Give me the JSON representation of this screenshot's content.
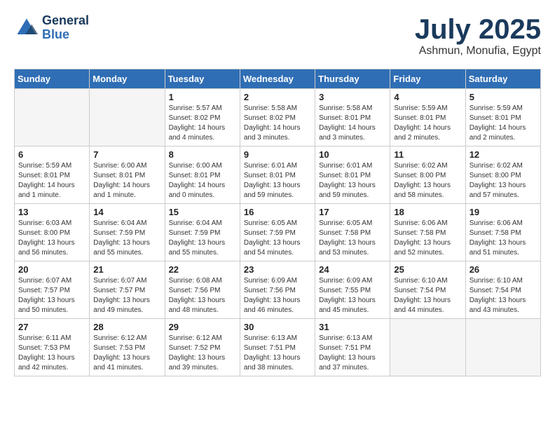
{
  "header": {
    "logo_general": "General",
    "logo_blue": "Blue",
    "month": "July 2025",
    "location": "Ashmun, Monufia, Egypt"
  },
  "weekdays": [
    "Sunday",
    "Monday",
    "Tuesday",
    "Wednesday",
    "Thursday",
    "Friday",
    "Saturday"
  ],
  "weeks": [
    [
      {
        "day": "",
        "info": ""
      },
      {
        "day": "",
        "info": ""
      },
      {
        "day": "1",
        "info": "Sunrise: 5:57 AM\nSunset: 8:02 PM\nDaylight: 14 hours and 4 minutes."
      },
      {
        "day": "2",
        "info": "Sunrise: 5:58 AM\nSunset: 8:02 PM\nDaylight: 14 hours and 3 minutes."
      },
      {
        "day": "3",
        "info": "Sunrise: 5:58 AM\nSunset: 8:01 PM\nDaylight: 14 hours and 3 minutes."
      },
      {
        "day": "4",
        "info": "Sunrise: 5:59 AM\nSunset: 8:01 PM\nDaylight: 14 hours and 2 minutes."
      },
      {
        "day": "5",
        "info": "Sunrise: 5:59 AM\nSunset: 8:01 PM\nDaylight: 14 hours and 2 minutes."
      }
    ],
    [
      {
        "day": "6",
        "info": "Sunrise: 5:59 AM\nSunset: 8:01 PM\nDaylight: 14 hours and 1 minute."
      },
      {
        "day": "7",
        "info": "Sunrise: 6:00 AM\nSunset: 8:01 PM\nDaylight: 14 hours and 1 minute."
      },
      {
        "day": "8",
        "info": "Sunrise: 6:00 AM\nSunset: 8:01 PM\nDaylight: 14 hours and 0 minutes."
      },
      {
        "day": "9",
        "info": "Sunrise: 6:01 AM\nSunset: 8:01 PM\nDaylight: 13 hours and 59 minutes."
      },
      {
        "day": "10",
        "info": "Sunrise: 6:01 AM\nSunset: 8:01 PM\nDaylight: 13 hours and 59 minutes."
      },
      {
        "day": "11",
        "info": "Sunrise: 6:02 AM\nSunset: 8:00 PM\nDaylight: 13 hours and 58 minutes."
      },
      {
        "day": "12",
        "info": "Sunrise: 6:02 AM\nSunset: 8:00 PM\nDaylight: 13 hours and 57 minutes."
      }
    ],
    [
      {
        "day": "13",
        "info": "Sunrise: 6:03 AM\nSunset: 8:00 PM\nDaylight: 13 hours and 56 minutes."
      },
      {
        "day": "14",
        "info": "Sunrise: 6:04 AM\nSunset: 7:59 PM\nDaylight: 13 hours and 55 minutes."
      },
      {
        "day": "15",
        "info": "Sunrise: 6:04 AM\nSunset: 7:59 PM\nDaylight: 13 hours and 55 minutes."
      },
      {
        "day": "16",
        "info": "Sunrise: 6:05 AM\nSunset: 7:59 PM\nDaylight: 13 hours and 54 minutes."
      },
      {
        "day": "17",
        "info": "Sunrise: 6:05 AM\nSunset: 7:58 PM\nDaylight: 13 hours and 53 minutes."
      },
      {
        "day": "18",
        "info": "Sunrise: 6:06 AM\nSunset: 7:58 PM\nDaylight: 13 hours and 52 minutes."
      },
      {
        "day": "19",
        "info": "Sunrise: 6:06 AM\nSunset: 7:58 PM\nDaylight: 13 hours and 51 minutes."
      }
    ],
    [
      {
        "day": "20",
        "info": "Sunrise: 6:07 AM\nSunset: 7:57 PM\nDaylight: 13 hours and 50 minutes."
      },
      {
        "day": "21",
        "info": "Sunrise: 6:07 AM\nSunset: 7:57 PM\nDaylight: 13 hours and 49 minutes."
      },
      {
        "day": "22",
        "info": "Sunrise: 6:08 AM\nSunset: 7:56 PM\nDaylight: 13 hours and 48 minutes."
      },
      {
        "day": "23",
        "info": "Sunrise: 6:09 AM\nSunset: 7:56 PM\nDaylight: 13 hours and 46 minutes."
      },
      {
        "day": "24",
        "info": "Sunrise: 6:09 AM\nSunset: 7:55 PM\nDaylight: 13 hours and 45 minutes."
      },
      {
        "day": "25",
        "info": "Sunrise: 6:10 AM\nSunset: 7:54 PM\nDaylight: 13 hours and 44 minutes."
      },
      {
        "day": "26",
        "info": "Sunrise: 6:10 AM\nSunset: 7:54 PM\nDaylight: 13 hours and 43 minutes."
      }
    ],
    [
      {
        "day": "27",
        "info": "Sunrise: 6:11 AM\nSunset: 7:53 PM\nDaylight: 13 hours and 42 minutes."
      },
      {
        "day": "28",
        "info": "Sunrise: 6:12 AM\nSunset: 7:53 PM\nDaylight: 13 hours and 41 minutes."
      },
      {
        "day": "29",
        "info": "Sunrise: 6:12 AM\nSunset: 7:52 PM\nDaylight: 13 hours and 39 minutes."
      },
      {
        "day": "30",
        "info": "Sunrise: 6:13 AM\nSunset: 7:51 PM\nDaylight: 13 hours and 38 minutes."
      },
      {
        "day": "31",
        "info": "Sunrise: 6:13 AM\nSunset: 7:51 PM\nDaylight: 13 hours and 37 minutes."
      },
      {
        "day": "",
        "info": ""
      },
      {
        "day": "",
        "info": ""
      }
    ]
  ]
}
